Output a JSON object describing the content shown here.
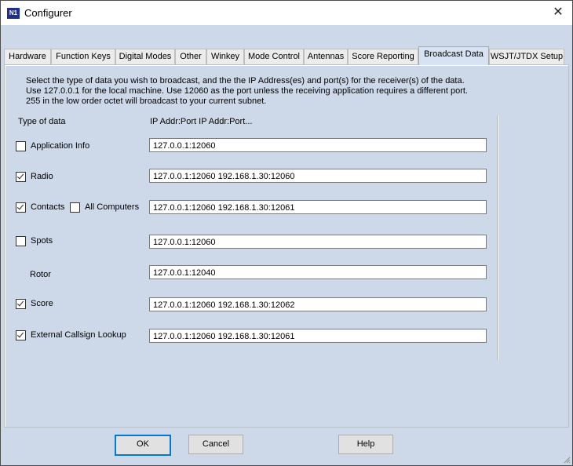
{
  "window": {
    "title": "Configurer",
    "logo_text": "N1"
  },
  "tabs": [
    "Hardware",
    "Function Keys",
    "Digital Modes",
    "Other",
    "Winkey",
    "Mode Control",
    "Antennas",
    "Score Reporting",
    "Broadcast Data",
    "WSJT/JTDX Setup"
  ],
  "active_tab": "Broadcast Data",
  "description": [
    "Select the type of data you wish to broadcast, and the the IP Address(es) and port(s) for the receiver(s) of the data.",
    "Use 127.0.0.1 for the local machine.  Use 12060 as the port unless the receiving application requires a different port.",
    "255 in the low order octet will broadcast to your current subnet."
  ],
  "headers": {
    "type": "Type of data",
    "ip": "IP Addr:Port IP Addr:Port..."
  },
  "rows": {
    "app_info": {
      "label": "Application Info",
      "checked": false,
      "value": "127.0.0.1:12060"
    },
    "radio": {
      "label": "Radio",
      "checked": true,
      "value": "127.0.0.1:12060 192.168.1.30:12060"
    },
    "contacts": {
      "label": "Contacts",
      "checked": true,
      "value": "127.0.0.1:12060 192.168.1.30:12061",
      "all_computers_label": "All Computers",
      "all_computers_checked": false
    },
    "spots": {
      "label": "Spots",
      "checked": false,
      "value": "127.0.0.1:12060"
    },
    "rotor": {
      "label": "Rotor",
      "value": "127.0.0.1:12040"
    },
    "score": {
      "label": "Score",
      "checked": true,
      "value": "127.0.0.1:12060 192.168.1.30:12062"
    },
    "callsign": {
      "label": "External Callsign Lookup",
      "checked": true,
      "value": "127.0.0.1:12060 192.168.1.30:12061"
    }
  },
  "buttons": {
    "ok": "OK",
    "cancel": "Cancel",
    "help": "Help"
  }
}
